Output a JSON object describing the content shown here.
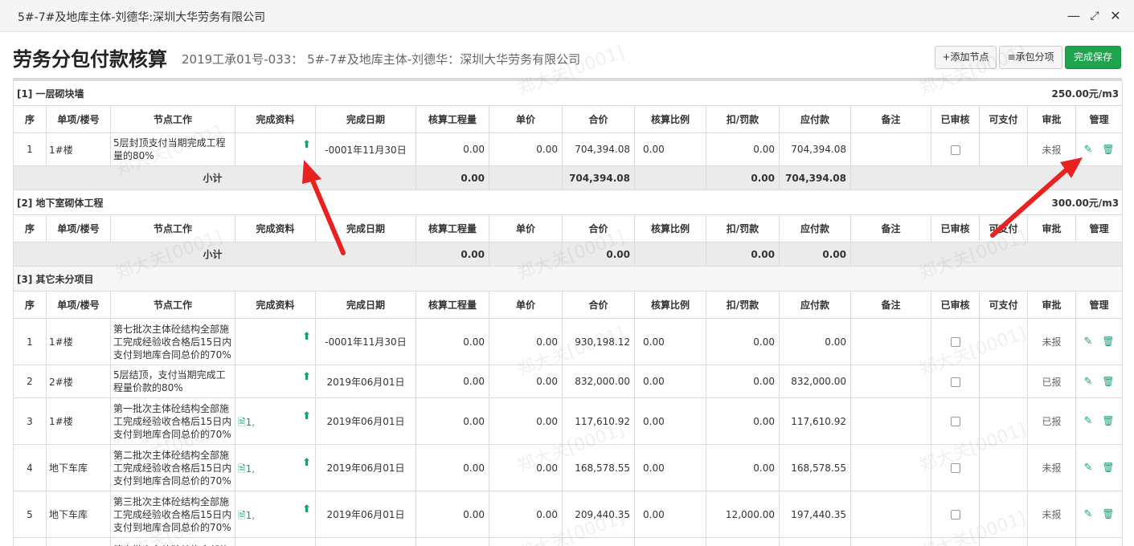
{
  "window": {
    "title": "5#-7#及地库主体-刘德华:深圳大华劳务有限公司",
    "controls": [
      "minimize-icon",
      "maximize-icon",
      "close-icon"
    ]
  },
  "header": {
    "title": "劳务分包付款核算",
    "subtitle": "2019工承01号-033： 5#-7#及地库主体-刘德华：深圳大华劳务有限公司",
    "buttons": {
      "add_node": "+添加节点",
      "contract_items": "≡承包分项",
      "save": "完成保存"
    }
  },
  "columns": [
    "序",
    "单项/楼号",
    "节点工作",
    "完成资料",
    "完成日期",
    "核算工程量",
    "单价",
    "合价",
    "核算比例",
    "扣/罚款",
    "应付款",
    "备注",
    "已审核",
    "可支付",
    "审批",
    "管理"
  ],
  "groups": [
    {
      "title": "[1] 一层砌块墙",
      "rate": "250.00元/m3",
      "rows": [
        {
          "seq": "1",
          "bldg": "1#楼",
          "work": "5层封顶支付当期完成工程量的80%",
          "docs": "",
          "date": "-0001年11月30日",
          "qty": "0.00",
          "price": "0.00",
          "amount": "704,394.08",
          "ratio": "0.00",
          "penalty": "0.00",
          "payable": "704,394.08",
          "status": "未报"
        }
      ],
      "subtotal": {
        "label": "小计",
        "qty": "0.00",
        "amount": "704,394.08",
        "penalty": "0.00",
        "payable": "704,394.08"
      }
    },
    {
      "title": "[2] 地下室砌体工程",
      "rate": "300.00元/m3",
      "rows": [],
      "subtotal": {
        "label": "小计",
        "qty": "0.00",
        "amount": "0.00",
        "penalty": "0.00",
        "payable": "0.00"
      }
    },
    {
      "title": "[3] 其它未分项目",
      "rate": "",
      "rows": [
        {
          "seq": "1",
          "bldg": "1#楼",
          "work": "第七批次主体砼结构全部施工完成经验收合格后15日内支付到地库合同总价的70%",
          "docs": "",
          "date": "-0001年11月30日",
          "qty": "0.00",
          "price": "0.00",
          "amount": "930,198.12",
          "ratio": "0.00",
          "penalty": "0.00",
          "payable": "0.00",
          "status": "未报"
        },
        {
          "seq": "2",
          "bldg": "2#楼",
          "work": "5层结顶，支付当期完成工程量价款的80%",
          "docs": "",
          "date": "2019年06月01日",
          "qty": "0.00",
          "price": "0.00",
          "amount": "832,000.00",
          "ratio": "0.00",
          "penalty": "0.00",
          "payable": "832,000.00",
          "status": "已报"
        },
        {
          "seq": "3",
          "bldg": "1#楼",
          "work": "第一批次主体砼结构全部施工完成经验收合格后15日内支付到地库合同总价的70%",
          "docs": "1,",
          "date": "2019年06月01日",
          "qty": "0.00",
          "price": "0.00",
          "amount": "117,610.92",
          "ratio": "0.00",
          "penalty": "0.00",
          "payable": "117,610.92",
          "status": "已报"
        },
        {
          "seq": "4",
          "bldg": "地下车库",
          "work": "第二批次主体砼结构全部施工完成经验收合格后15日内支付到地库合同总价的70%",
          "docs": "1,",
          "date": "2019年06月01日",
          "qty": "0.00",
          "price": "0.00",
          "amount": "168,578.55",
          "ratio": "0.00",
          "penalty": "0.00",
          "payable": "168,578.55",
          "status": "未报"
        },
        {
          "seq": "5",
          "bldg": "地下车库",
          "work": "第三批次主体砼结构全部施工完成经验收合格后15日内支付到地库合同总价的70%",
          "docs": "1,",
          "date": "2019年06月01日",
          "qty": "0.00",
          "price": "0.00",
          "amount": "209,440.35",
          "ratio": "0.00",
          "penalty": "12,000.00",
          "payable": "197,440.35",
          "status": "未报"
        }
      ]
    }
  ],
  "partial_next_row_text": "第六批次主体砼结构全部施",
  "watermark": "郑大关[0001]",
  "colors": {
    "accent": "#1ea34f",
    "icon": "#1a9c7a",
    "arrow": "#e8231f"
  }
}
